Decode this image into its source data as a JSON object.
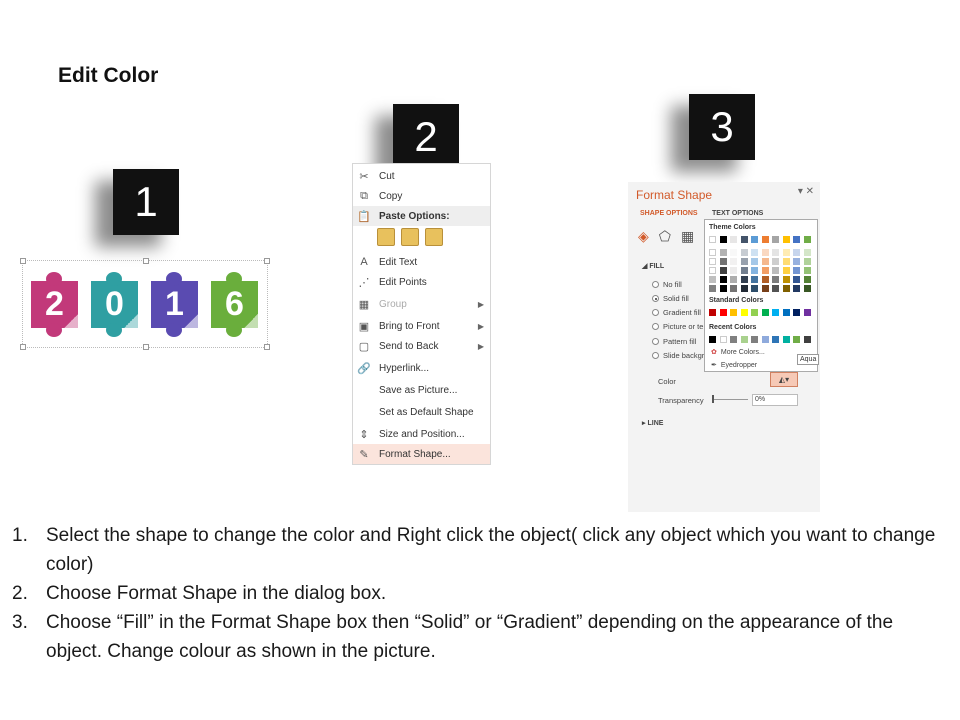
{
  "title": "Edit Color",
  "step_badges": [
    "1",
    "2",
    "3"
  ],
  "puzzle": {
    "pieces": [
      {
        "label": "2",
        "color": "#c2397a"
      },
      {
        "label": "0",
        "color": "#2f9fa2"
      },
      {
        "label": "1",
        "color": "#5a4bb1"
      },
      {
        "label": "6",
        "color": "#6aae3c"
      }
    ]
  },
  "context_menu": {
    "items": [
      {
        "label": "Cut",
        "icon": "scissors-icon",
        "glyph": "✂"
      },
      {
        "label": "Copy",
        "icon": "copy-icon",
        "glyph": "⧉"
      },
      {
        "label": "Paste Options:",
        "icon": "paste-icon",
        "glyph": "📋"
      },
      {
        "label": "Edit Text",
        "icon": "edit-text-icon",
        "glyph": "A"
      },
      {
        "label": "Edit Points",
        "icon": "edit-points-icon",
        "glyph": "⋰"
      },
      {
        "label": "Group",
        "icon": "group-icon",
        "glyph": "▦"
      },
      {
        "label": "Bring to Front",
        "icon": "bring-front-icon",
        "glyph": "▣"
      },
      {
        "label": "Send to Back",
        "icon": "send-back-icon",
        "glyph": "▢"
      },
      {
        "label": "Hyperlink...",
        "icon": "hyperlink-icon",
        "glyph": "🔗"
      },
      {
        "label": "Save as Picture...",
        "icon": "",
        "glyph": ""
      },
      {
        "label": "Set as Default Shape",
        "icon": "",
        "glyph": ""
      },
      {
        "label": "Size and Position...",
        "icon": "size-position-icon",
        "glyph": "⇕"
      },
      {
        "label": "Format Shape...",
        "icon": "format-shape-icon",
        "glyph": "✎"
      }
    ]
  },
  "format_pane": {
    "title": "Format Shape",
    "tabs": [
      "SHAPE OPTIONS",
      "TEXT OPTIONS"
    ],
    "fill_section": "FILL",
    "fill_options": [
      "No fill",
      "Solid fill",
      "Gradient fill",
      "Picture or te",
      "Pattern fill",
      "Slide backgr"
    ],
    "color_label": "Color",
    "transparency_label": "Transparency",
    "transparency_value": "0%",
    "line_section": "LINE"
  },
  "color_picker": {
    "theme_label": "Theme Colors",
    "standard_label": "Standard Colors",
    "recent_label": "Recent Colors",
    "more_colors": "More Colors...",
    "eyedropper": "Eyedropper",
    "tooltip": "Aqua",
    "theme_top": [
      "#ffffff",
      "#000000",
      "#e7e6e6",
      "#44546a",
      "#5b9bd5",
      "#ed7d31",
      "#a5a5a5",
      "#ffc000",
      "#4472c4",
      "#70ad47"
    ],
    "standard": [
      "#c00000",
      "#ff0000",
      "#ffc000",
      "#ffff00",
      "#92d050",
      "#00b050",
      "#00b0f0",
      "#0070c0",
      "#002060",
      "#7030a0"
    ],
    "recent": [
      "#000000",
      "#ffffff",
      "#808080",
      "#a9d18e",
      "#7f7f7f",
      "#8faadc",
      "#2e75b6",
      "#00b0a0",
      "#70ad47",
      "#404040"
    ]
  },
  "instructions": [
    {
      "num": "1.",
      "text": "Select the shape to change the color and Right click the object( click any object which you want to change color)"
    },
    {
      "num": "2.",
      "text": "Choose Format Shape in the dialog box."
    },
    {
      "num": "3.",
      "text": "Choose “Fill” in the Format Shape box then “Solid” or “Gradient” depending on the appearance of the object. Change colour as shown in the picture."
    }
  ]
}
